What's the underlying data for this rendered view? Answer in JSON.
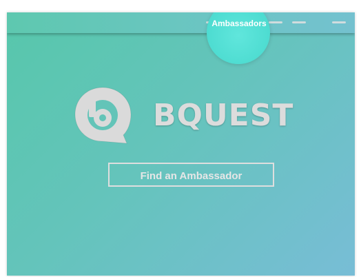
{
  "nav": {
    "active_link": "Ambassadors"
  },
  "brand": {
    "name": "BQUEST"
  },
  "hero": {
    "cta_label": "Find an Ambassador"
  },
  "icons": {
    "logo": "bquest-logo-icon",
    "menu_items": [
      "nav-link-placeholder",
      "nav-link-placeholder"
    ]
  },
  "colors": {
    "background_start": "#57c7ab",
    "background_end": "#78bdd6",
    "navbar": "#66c6bd",
    "active_nav_highlight": "#4fddd2",
    "brand_text": "#dcdcdc",
    "button_border": "#dedede"
  }
}
